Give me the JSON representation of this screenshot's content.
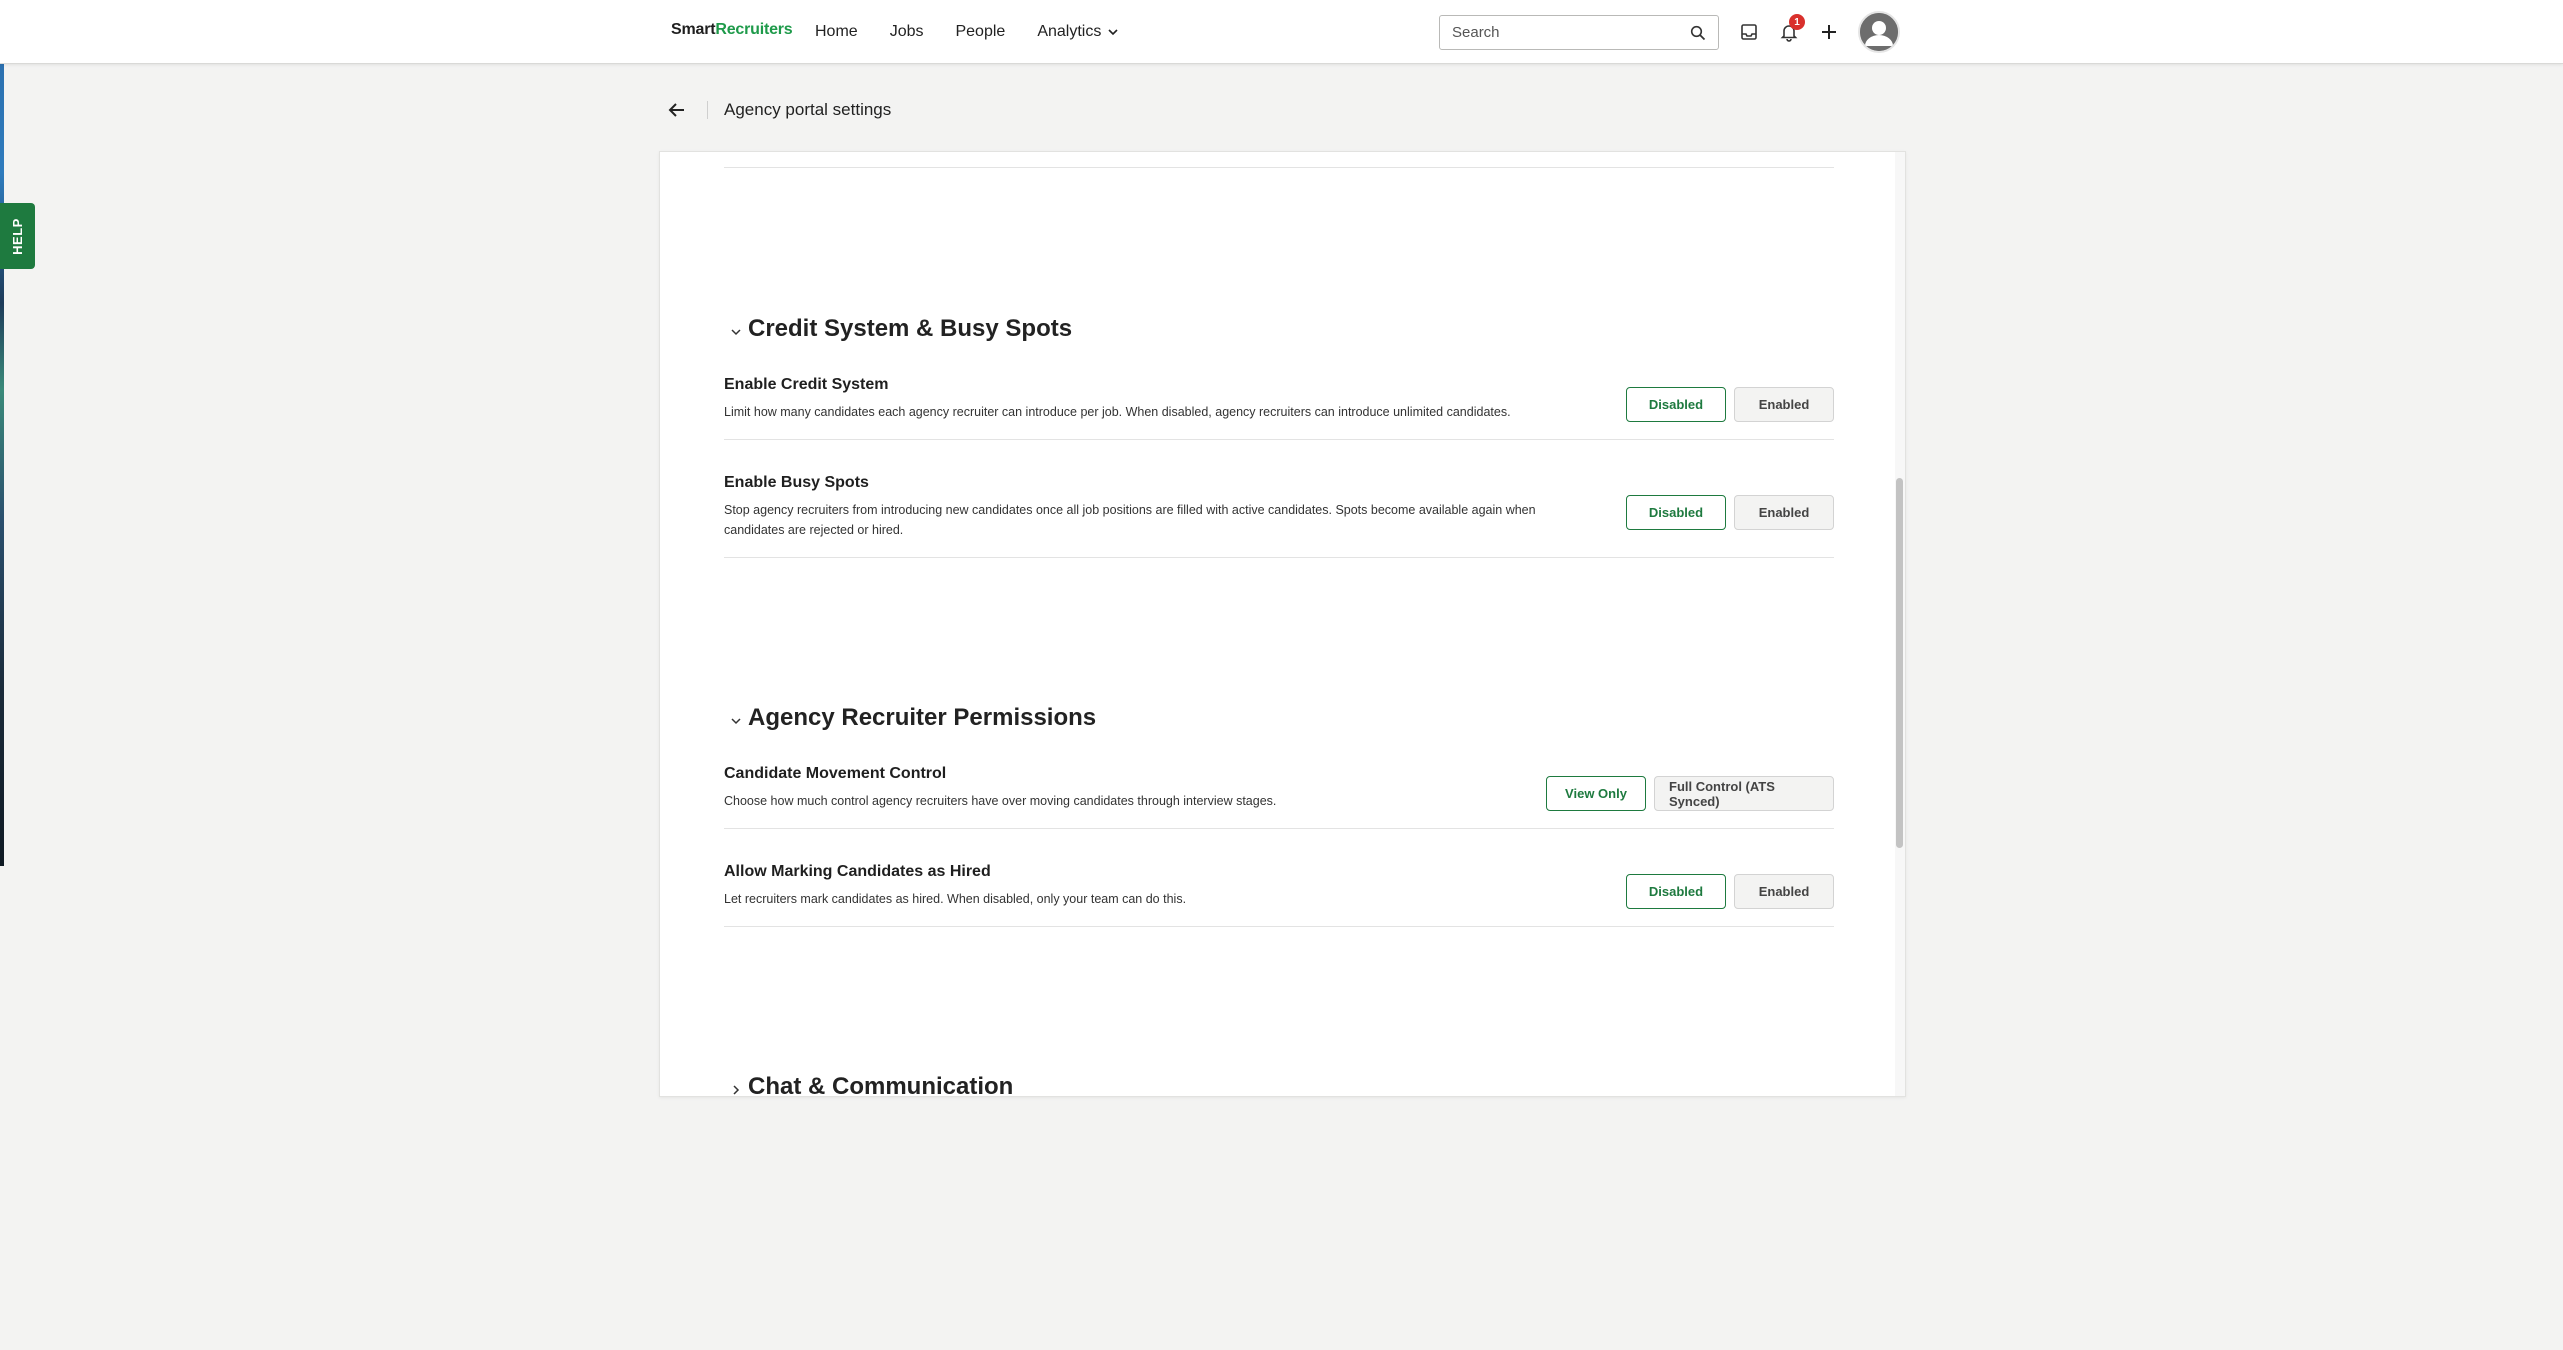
{
  "nav": {
    "logo_smart": "Smart",
    "logo_recruiters": "Recruiters",
    "links": [
      "Home",
      "Jobs",
      "People",
      "Analytics"
    ],
    "search_placeholder": "Search",
    "notification_count": "1"
  },
  "help": {
    "label": "HELP"
  },
  "header": {
    "title": "Agency portal settings"
  },
  "sections": [
    {
      "title": "Credit System & Busy Spots",
      "rows": [
        {
          "title": "Enable Credit System",
          "desc": "Limit how many candidates each agency recruiter can introduce per job. When disabled, agency recruiters can introduce unlimited candidates.",
          "options": [
            "Disabled",
            "Enabled"
          ]
        },
        {
          "title": "Enable Busy Spots",
          "desc": "Stop agency recruiters from introducing new candidates once all job positions are filled with active candidates. Spots become available again when candidates are rejected or hired.",
          "options": [
            "Disabled",
            "Enabled"
          ]
        }
      ]
    },
    {
      "title": "Agency Recruiter Permissions",
      "rows": [
        {
          "title": "Candidate Movement Control",
          "desc": "Choose how much control agency recruiters have over moving candidates through interview stages.",
          "options": [
            "View Only",
            "Full Control (ATS Synced)"
          ]
        },
        {
          "title": "Allow Marking Candidates as Hired",
          "desc": "Let recruiters mark candidates as hired. When disabled, only your team can do this.",
          "options": [
            "Disabled",
            "Enabled"
          ]
        }
      ]
    },
    {
      "title": "Chat & Communication"
    }
  ],
  "colors": {
    "accent": "#1e7a3f",
    "brand_green": "#1e9a4a",
    "badge": "#d9302c"
  }
}
